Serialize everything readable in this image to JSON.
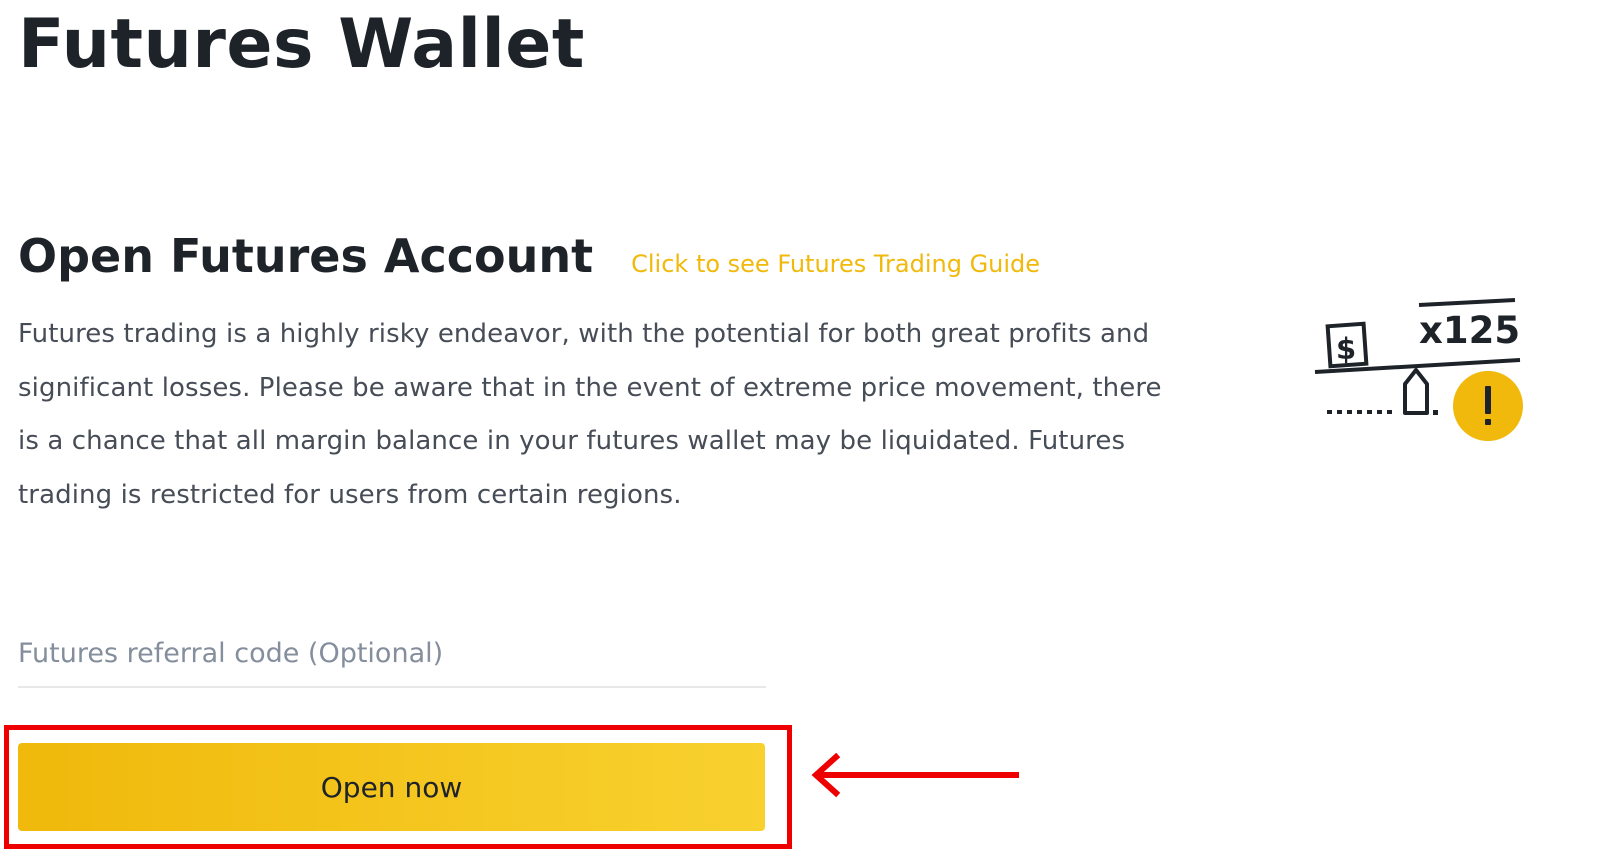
{
  "page": {
    "title": "Futures Wallet"
  },
  "section": {
    "title": "Open Futures Account",
    "guide_link": "Click to see Futures Trading Guide",
    "description": "Futures trading is a highly risky endeavor, with the potential for both great profits and significant losses. Please be aware that in the event of extreme price movement, there is a chance that all margin balance in your futures wallet may be liquidated. Futures trading is restricted for users from certain regions."
  },
  "referral": {
    "value": "",
    "placeholder": "Futures referral code (Optional)"
  },
  "actions": {
    "open_label": "Open now"
  },
  "illustration": {
    "icon": "leverage-risk-illustration",
    "currency_symbol": "$",
    "leverage_label": "x125",
    "warning_symbol": "!"
  },
  "annotation": {
    "highlight_color": "#ee0000",
    "arrow_icon": "left-arrow-icon"
  },
  "colors": {
    "accent": "#f0b90b",
    "accent_light": "#f8d12f",
    "title_text": "#1e2329",
    "body_text": "#474d57",
    "placeholder_text": "#848e9c",
    "annotation_red": "#ee0000"
  }
}
